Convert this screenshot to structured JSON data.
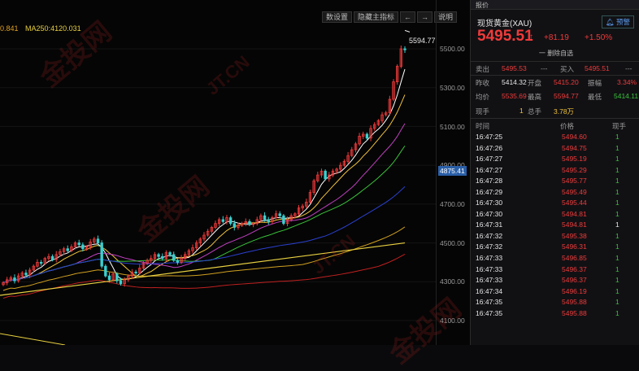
{
  "chart": {
    "ma_items": [
      {
        "text": "0.841",
        "color": "#e0a020"
      },
      {
        "text": "MA250:4120.031",
        "color": "#e8d040"
      }
    ],
    "toolbar": [
      "数设置",
      "隐藏主指标",
      "←",
      "→",
      "说明"
    ],
    "y_ticks": [
      "5500.00",
      "5300.00",
      "5100.00",
      "4900.00",
      "4700.00",
      "4500.00",
      "4300.00",
      "4100.00"
    ],
    "current_price": "4875.41",
    "high_label": "5594.77",
    "watermark": [
      "金投网",
      "JT.CN"
    ]
  },
  "chart_data": {
    "type": "candlestick",
    "ylim": [
      4060,
      5640
    ],
    "ticks": [
      5500,
      5300,
      5100,
      4900,
      4700,
      4500,
      4300,
      4100
    ],
    "closes": [
      4295,
      4310,
      4320,
      4305,
      4330,
      4345,
      4335,
      4360,
      4380,
      4400,
      4395,
      4420,
      4430,
      4415,
      4440,
      4455,
      4470,
      4460,
      4480,
      4500,
      4490,
      4470,
      4480,
      4505,
      4520,
      4500,
      4380,
      4330,
      4310,
      4340,
      4305,
      4290,
      4310,
      4330,
      4350,
      4345,
      4370,
      4395,
      4410,
      4420,
      4440,
      4430,
      4420,
      4450,
      4440,
      4410,
      4400,
      4420,
      4440,
      4460,
      4475,
      4500,
      4520,
      4540,
      4560,
      4580,
      4600,
      4620,
      4610,
      4630,
      4600,
      4580,
      4590,
      4600,
      4610,
      4595,
      4600,
      4620,
      4640,
      4620,
      4610,
      4630,
      4650,
      4640,
      4600,
      4620,
      4640,
      4650,
      4680,
      4690,
      4710,
      4760,
      4820,
      4850,
      4870,
      4830,
      4850,
      4870,
      4880,
      4900,
      4920,
      4950,
      4980,
      5010,
      5050,
      5060,
      5040,
      5090,
      5110,
      5130,
      5160,
      5170,
      5240,
      5330,
      5410,
      5500,
      5495
    ]
  },
  "panel": {
    "tab": "报价",
    "title": "现货黄金(XAU)",
    "warn": "预警",
    "price": "5495.51",
    "arrow": "↑",
    "change": "+81.19",
    "pct": "+1.50%",
    "del": "一 删除自选",
    "sell_label": "卖出",
    "sell": "5495.53",
    "sell_dash": "---",
    "buy_label": "买入",
    "buy": "5495.51",
    "buy_dash": "---",
    "r1": {
      "l1": "昨收",
      "v1": "5414.32",
      "l2": "开盘",
      "v2": "5415.20",
      "l3": "振幅",
      "v3": "3.34%"
    },
    "r2": {
      "l1": "均价",
      "v1": "5535.69",
      "l2": "最高",
      "v2": "5594.77",
      "l3": "最低",
      "v3": "5414.11"
    },
    "r3": {
      "l1": "现手",
      "v1": "1",
      "l2": "总手",
      "v2": "3.78万"
    },
    "th": [
      "时间",
      "价格",
      "现手"
    ],
    "trades": [
      [
        "16:47:25",
        "5494.60",
        "1"
      ],
      [
        "16:47:26",
        "5494.75",
        "1"
      ],
      [
        "16:47:27",
        "5495.19",
        "1"
      ],
      [
        "16:47:27",
        "5495.29",
        "1"
      ],
      [
        "16:47:28",
        "5495.77",
        "1"
      ],
      [
        "16:47:29",
        "5495.49",
        "1"
      ],
      [
        "16:47:30",
        "5495.44",
        "1"
      ],
      [
        "16:47:30",
        "5494.81",
        "1"
      ],
      [
        "16:47:31",
        "5494.81",
        "1"
      ],
      [
        "16:47:32",
        "5495.38",
        "1"
      ],
      [
        "16:47:32",
        "5496.31",
        "1"
      ],
      [
        "16:47:33",
        "5496.85",
        "1"
      ],
      [
        "16:47:33",
        "5496.37",
        "1"
      ],
      [
        "16:47:33",
        "5496.37",
        "1"
      ],
      [
        "16:47:34",
        "5496.19",
        "1"
      ],
      [
        "16:47:35",
        "5495.88",
        "1"
      ],
      [
        "16:47:35",
        "5495.88",
        "1"
      ]
    ],
    "trade_qty_colors": [
      "green",
      "green",
      "green",
      "green",
      "green",
      "green",
      "green",
      "green",
      "white",
      "green",
      "green",
      "green",
      "green",
      "green",
      "green",
      "green",
      "green"
    ]
  }
}
